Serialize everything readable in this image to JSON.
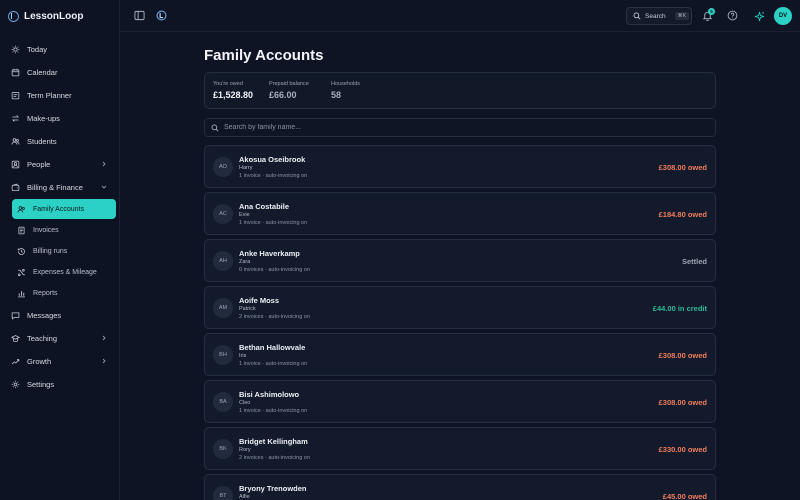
{
  "app": {
    "name": "LessonLoop"
  },
  "nav": {
    "items": [
      {
        "label": "Today",
        "icon": "sun-icon"
      },
      {
        "label": "Calendar",
        "icon": "calendar-icon"
      },
      {
        "label": "Term Planner",
        "icon": "planner-icon"
      },
      {
        "label": "Make-ups",
        "icon": "swap-icon"
      },
      {
        "label": "Students",
        "icon": "students-icon"
      },
      {
        "label": "People",
        "icon": "people-icon",
        "chevron": "right"
      },
      {
        "label": "Billing & Finance",
        "icon": "wallet-icon",
        "chevron": "down"
      },
      {
        "label": "Family Accounts",
        "icon": "family-icon",
        "active": true
      },
      {
        "label": "Invoices",
        "icon": "invoice-icon"
      },
      {
        "label": "Billing runs",
        "icon": "history-icon"
      },
      {
        "label": "Expenses & Mileage",
        "icon": "expenses-icon"
      },
      {
        "label": "Reports",
        "icon": "chart-icon"
      },
      {
        "label": "Messages",
        "icon": "message-icon"
      },
      {
        "label": "Teaching",
        "icon": "teaching-icon",
        "chevron": "right"
      },
      {
        "label": "Growth",
        "icon": "growth-icon",
        "chevron": "right"
      },
      {
        "label": "Settings",
        "icon": "gear-icon"
      }
    ]
  },
  "topbar": {
    "search_label": "Search",
    "search_shortcut": "⌘K",
    "notification_count": "5",
    "user_initials": "DV"
  },
  "page": {
    "title": "Family Accounts",
    "summary": {
      "owed_label": "You're owed",
      "owed_value": "£1,528.80",
      "prepaid_label": "Prepaid balance",
      "prepaid_value": "£66.00",
      "households_label": "Households",
      "households_value": "58"
    },
    "search_placeholder": "Search by family name..."
  },
  "families": [
    {
      "initials": "AO",
      "name": "Akosua Oseibrook",
      "students": "Harry",
      "meta": "1 invoice · auto-invoicing on",
      "status": "£308.00 owed",
      "status_type": "owed"
    },
    {
      "initials": "AC",
      "name": "Ana Costabile",
      "students": "Evie",
      "meta": "1 invoice · auto-invoicing on",
      "status": "£184.80 owed",
      "status_type": "owed"
    },
    {
      "initials": "AH",
      "name": "Anke Haverkamp",
      "students": "Zara",
      "meta": "0 invoices · auto-invoicing on",
      "status": "Settled",
      "status_type": "settled"
    },
    {
      "initials": "AM",
      "name": "Aoife Moss",
      "students": "Patrick",
      "meta": "2 invoices · auto-invoicing on",
      "status": "£44.00 in credit",
      "status_type": "credit"
    },
    {
      "initials": "BH",
      "name": "Bethan Hallowvale",
      "students": "Iris",
      "meta": "1 invoice · auto-invoicing on",
      "status": "£308.00 owed",
      "status_type": "owed"
    },
    {
      "initials": "BA",
      "name": "Bisi Ashimolowo",
      "students": "Cleo",
      "meta": "1 invoice · auto-invoicing on",
      "status": "£308.00 owed",
      "status_type": "owed"
    },
    {
      "initials": "BK",
      "name": "Bridget Kellingham",
      "students": "Rory",
      "meta": "2 invoices · auto-invoicing on",
      "status": "£330.00 owed",
      "status_type": "owed"
    },
    {
      "initials": "BT",
      "name": "Bryony Trenowden",
      "students": "Alfie",
      "meta": "",
      "status": "£45.00 owed",
      "status_type": "owed"
    }
  ]
}
